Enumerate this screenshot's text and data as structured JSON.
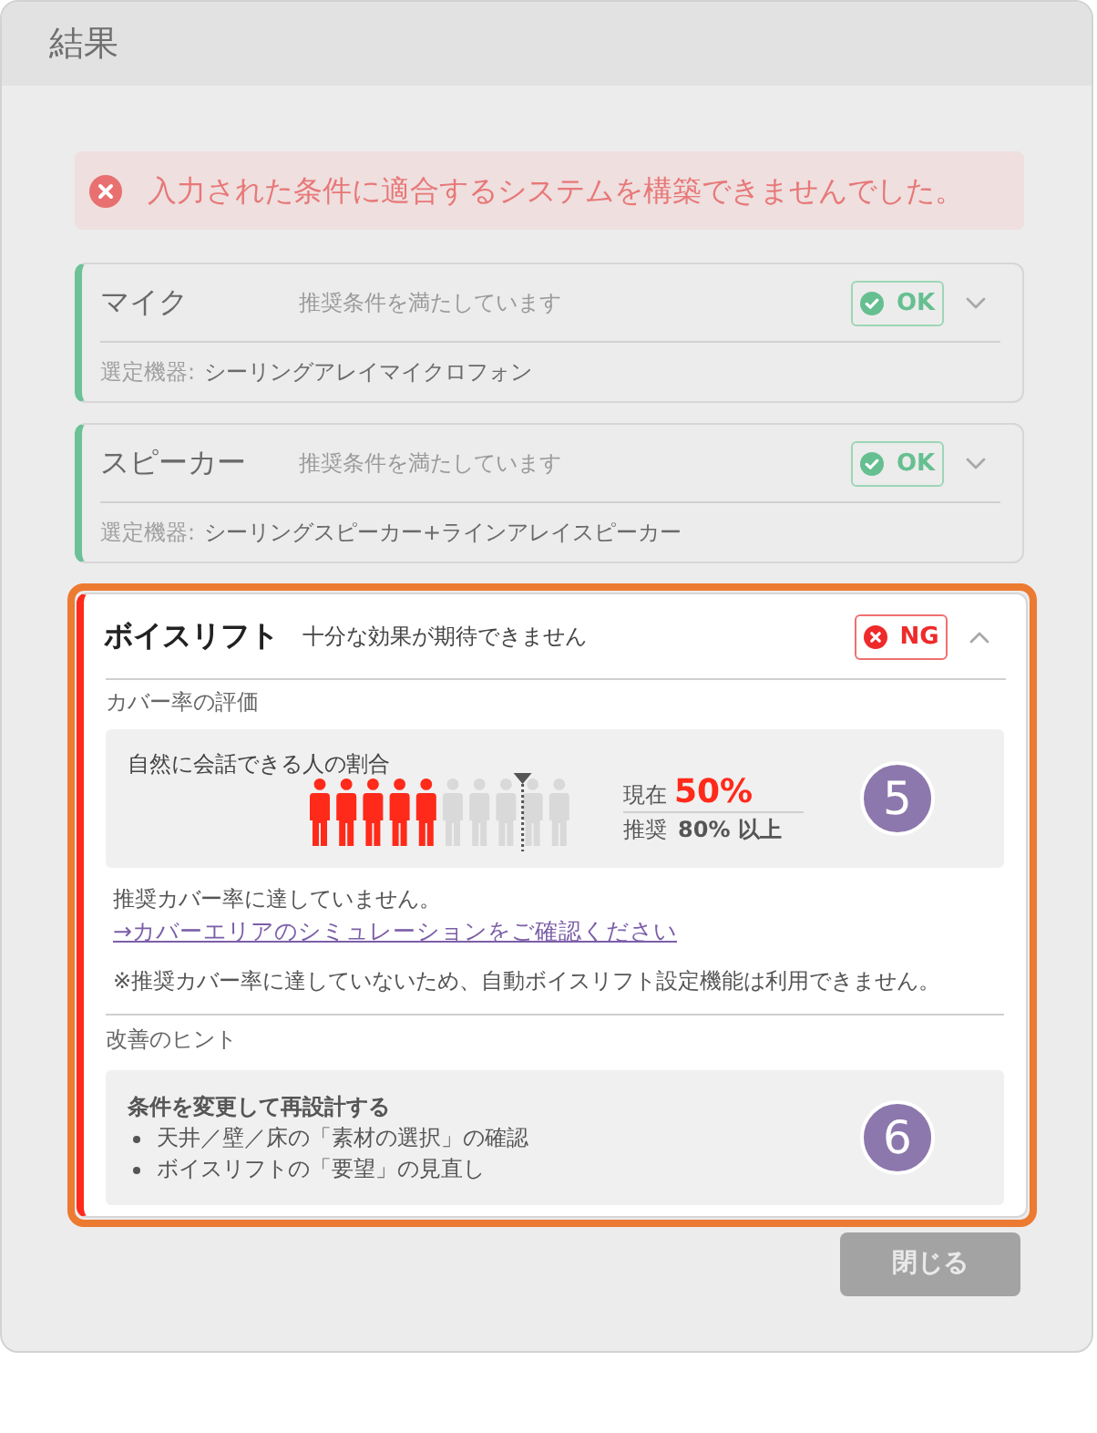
{
  "dialog": {
    "title": "結果"
  },
  "error_banner": {
    "message": "入力された条件に適合するシステムを構築できませんでした。"
  },
  "results": [
    {
      "name": "マイク",
      "summary": "推奨条件を満たしています",
      "kind": "ok",
      "status_label": "OK",
      "expanded": false,
      "highlighted": false,
      "device_label": "選定機器:",
      "device": "シーリングアレイマイクロフォン"
    },
    {
      "name": "スピーカー",
      "summary": "推奨条件を満たしています",
      "kind": "ok",
      "status_label": "OK",
      "expanded": false,
      "highlighted": false,
      "device_label": "選定機器:",
      "device": "シーリングスピーカー+ラインアレイスピーカー"
    },
    {
      "name": "ボイスリフト",
      "summary": "十分な効果が期待できません",
      "kind": "ng",
      "status_label": "NG",
      "expanded": true,
      "highlighted": true,
      "evaluation": {
        "heading": "カバー率の評価",
        "title": "自然に会話できる人の割合",
        "current": {
          "label": "現在",
          "value": "50%",
          "level": 0.5
        },
        "recommended": {
          "label": "推奨",
          "value": "80% 以上",
          "level": 0.8
        },
        "callout": "5"
      },
      "message": "推奨カバー率に達していません。",
      "link": "→カバーエリアのシミュレーションをご確認ください",
      "note": "※推奨カバー率に達していないため、自動ボイスリフト設定機能は利用できません。",
      "hints": {
        "heading": "改善のヒント",
        "title": "条件を変更して再設計する",
        "items": [
          "天井／壁／床の「素材の選択」の確認",
          "ボイスリフトの「要望」の見直し"
        ],
        "callout": "6"
      }
    }
  ],
  "close_button": "閉じる"
}
